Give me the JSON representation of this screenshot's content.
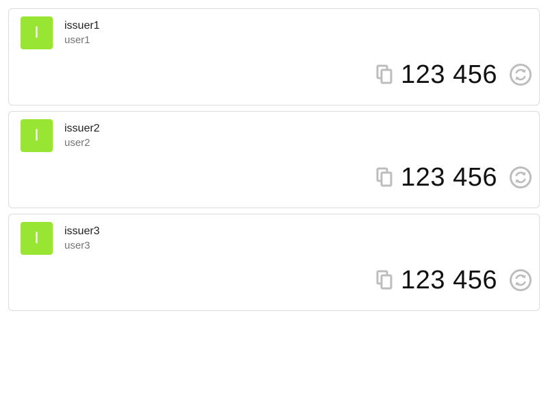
{
  "colors": {
    "avatar_bg": "#99e533",
    "icon_gray": "#bdbdbd",
    "card_border": "#dcdcdc"
  },
  "accounts": [
    {
      "initial": "I",
      "issuer": "issuer1",
      "account": "user1",
      "code": "123 456"
    },
    {
      "initial": "I",
      "issuer": "issuer2",
      "account": "user2",
      "code": "123 456"
    },
    {
      "initial": "I",
      "issuer": "issuer3",
      "account": "user3",
      "code": "123 456"
    }
  ],
  "icons": {
    "copy": "copy-icon",
    "refresh": "refresh-icon"
  }
}
